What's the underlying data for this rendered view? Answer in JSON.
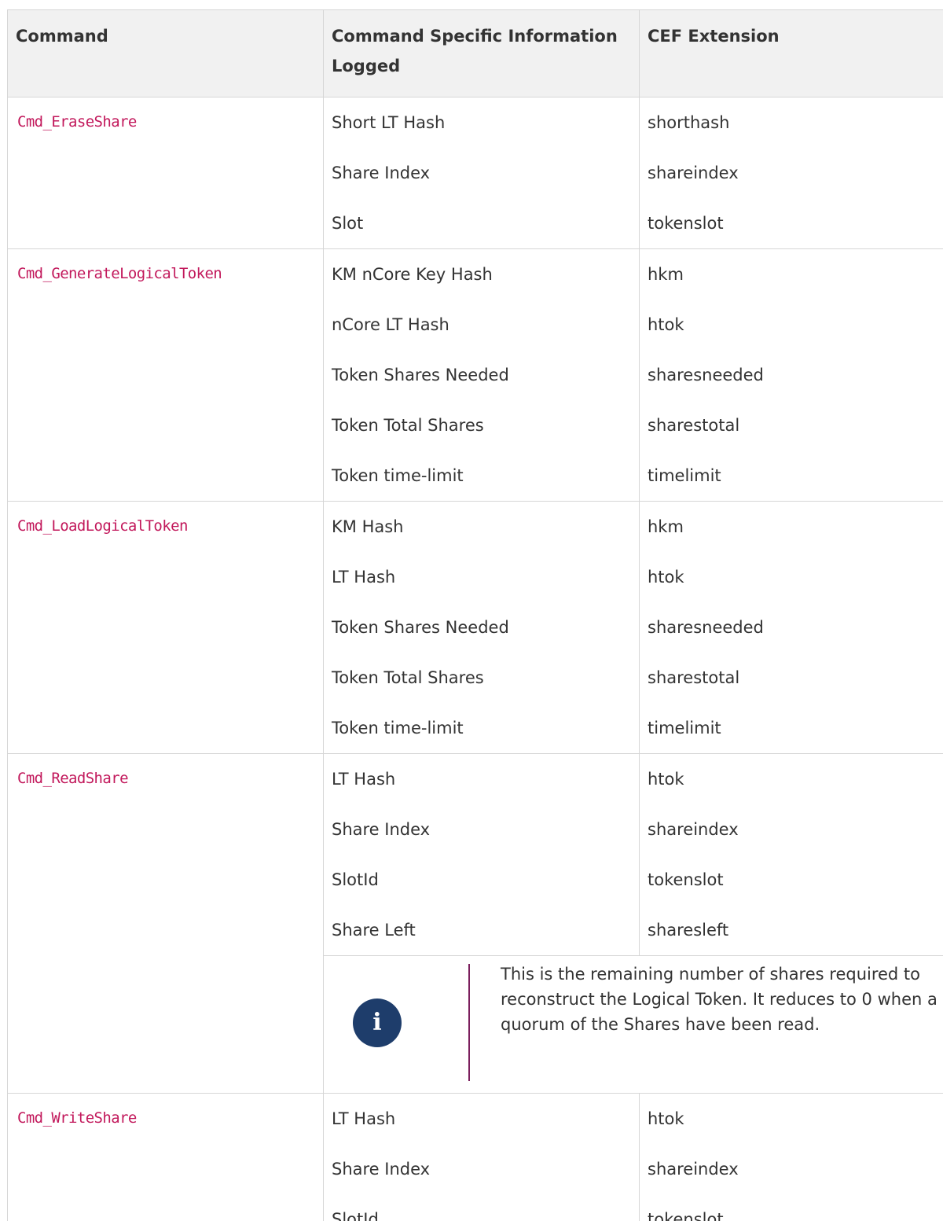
{
  "table": {
    "headers": {
      "command": "Command",
      "info": "Command Specific Information Logged",
      "cef": "CEF Extension"
    },
    "rows": [
      {
        "command": "Cmd_EraseShare",
        "info": [
          "Short LT Hash",
          "Share Index",
          "Slot"
        ],
        "cef": [
          "shorthash",
          "shareindex",
          "tokenslot"
        ]
      },
      {
        "command": "Cmd_GenerateLogicalToken",
        "info": [
          "KM nCore Key Hash",
          "nCore LT Hash",
          "Token Shares Needed",
          "Token Total Shares",
          "Token time-limit"
        ],
        "cef": [
          "hkm",
          "htok",
          "sharesneeded",
          "sharestotal",
          "timelimit"
        ]
      },
      {
        "command": "Cmd_LoadLogicalToken",
        "info": [
          "KM Hash",
          "LT Hash",
          "Token Shares Needed",
          "Token Total Shares",
          "Token time-limit"
        ],
        "cef": [
          "hkm",
          "htok",
          "sharesneeded",
          "sharestotal",
          "timelimit"
        ]
      },
      {
        "command": "Cmd_ReadShare",
        "info": [
          "LT Hash",
          "Share Index",
          "SlotId",
          "Share Left"
        ],
        "cef": [
          "htok",
          "shareindex",
          "tokenslot",
          "sharesleft"
        ],
        "note": {
          "icon": "info-icon",
          "text": "This is the remaining number of shares required to reconstruct the Logical Token. It reduces to 0 when a quorum of the Shares have been read."
        }
      },
      {
        "command": "Cmd_WriteShare",
        "info": [
          "LT Hash",
          "Share Index",
          "SlotId"
        ],
        "cef": [
          "htok",
          "shareindex",
          "tokenslot"
        ]
      }
    ]
  }
}
